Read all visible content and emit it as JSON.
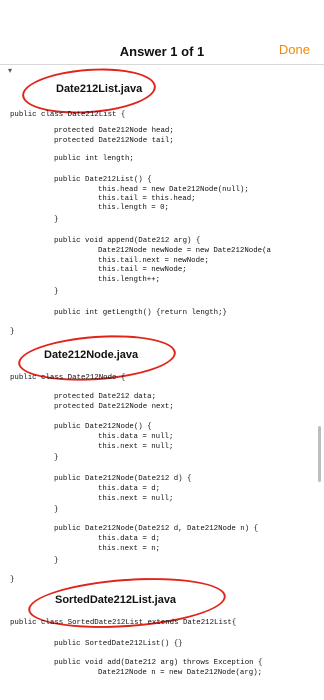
{
  "header": {
    "title": "Answer 1 of 1",
    "done_label": "Done"
  },
  "files": [
    {
      "name": "Date212List.java"
    },
    {
      "name": "Date212Node.java"
    },
    {
      "name": "SortedDate212List.java"
    }
  ],
  "code": {
    "l1": "public class Date212List {",
    "l2": "protected Date212Node head;",
    "l3": "protected Date212Node tail;",
    "l4": "public int length;",
    "l5": "public Date212List() {",
    "l6": "this.head = new Date212Node(null);",
    "l7": "this.tail = this.head;",
    "l8": "this.length = 0;",
    "l9": "}",
    "l10": "public void append(Date212 arg) {",
    "l11": "Date212Node newNode = new Date212Node(a",
    "l12": "this.tail.next = newNode;",
    "l13": "this.tail = newNode;",
    "l14": "this.length++;",
    "l15": "}",
    "l16": "public int getLength() {return length;}",
    "l17": "}",
    "n1": "public class Date212Node {",
    "n2": "protected Date212 data;",
    "n3": "protected Date212Node next;",
    "n4": "public Date212Node() {",
    "n5": "this.data = null;",
    "n6": "this.next = null;",
    "n7": "}",
    "n8": "public Date212Node(Date212 d) {",
    "n9": "this.data = d;",
    "n10": "this.next = null;",
    "n11": "}",
    "n12": "public Date212Node(Date212 d, Date212Node n) {",
    "n13": "this.data = d;",
    "n14": "this.next = n;",
    "n15": "}",
    "n16": "}",
    "s1": "public class SortedDate212List extends Date212List{",
    "s2": "public SortedDate212List() {}",
    "s3": "public void add(Date212 arg) throws Exception {",
    "s4": "Date212Node n = new Date212Node(arg);"
  }
}
